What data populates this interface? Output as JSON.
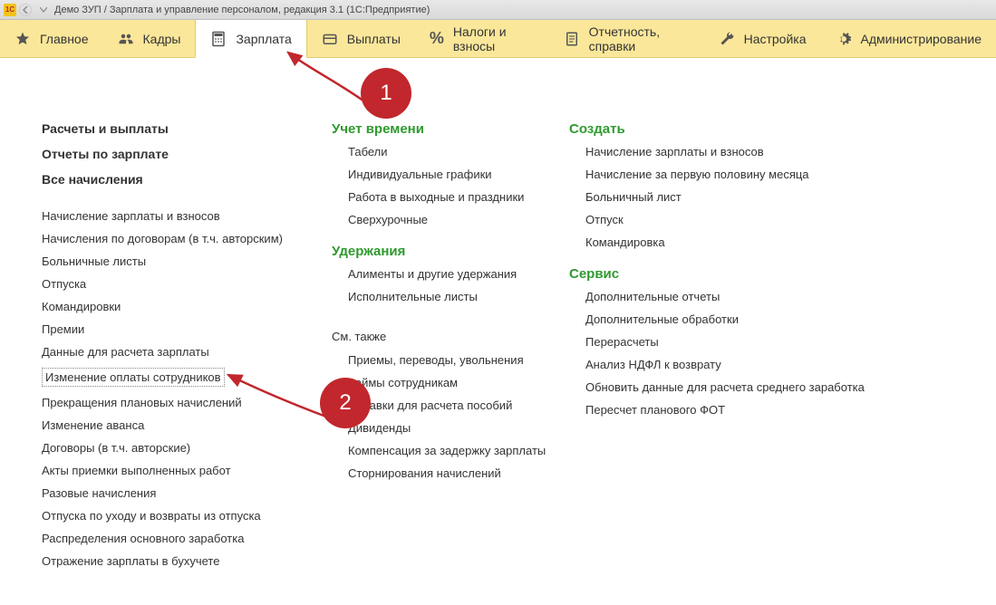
{
  "window": {
    "title": "Демо ЗУП / Зарплата и управление персоналом, редакция 3.1  (1С:Предприятие)"
  },
  "nav": {
    "items": [
      {
        "label": "Главное",
        "icon": "star-icon"
      },
      {
        "label": "Кадры",
        "icon": "people-icon"
      },
      {
        "label": "Зарплата",
        "icon": "calculator-icon",
        "active": true
      },
      {
        "label": "Выплаты",
        "icon": "wallet-icon"
      },
      {
        "label": "Налоги и взносы",
        "icon": "percent-icon"
      },
      {
        "label": "Отчетность, справки",
        "icon": "report-icon"
      },
      {
        "label": "Настройка",
        "icon": "wrench-icon"
      },
      {
        "label": "Администрирование",
        "icon": "gear-icon"
      }
    ]
  },
  "col1": {
    "top": [
      "Расчеты и выплаты",
      "Отчеты по зарплате",
      "Все начисления"
    ],
    "links": [
      "Начисление зарплаты и взносов",
      "Начисления по договорам (в т.ч. авторским)",
      "Больничные листы",
      "Отпуска",
      "Командировки",
      "Премии",
      "Данные для расчета зарплаты",
      "Изменение оплаты сотрудников",
      "Прекращения плановых начислений",
      "Изменение аванса",
      "Договоры (в т.ч. авторские)",
      "Акты приемки выполненных работ",
      "Разовые начисления",
      "Отпуска по уходу и возвраты из отпуска",
      "Распределения основного заработка",
      "Отражение зарплаты в бухучете"
    ]
  },
  "col2": {
    "sections": [
      {
        "head": "Учет времени",
        "items": [
          "Табели",
          "Индивидуальные графики",
          "Работа в выходные и праздники",
          "Сверхурочные"
        ]
      },
      {
        "head": "Удержания",
        "items": [
          "Алименты и другие удержания",
          "Исполнительные листы"
        ]
      }
    ],
    "seealso_label": "См. также",
    "seealso": [
      "Приемы, переводы, увольнения",
      "Займы сотрудникам",
      "Справки для расчета пособий",
      "Дивиденды",
      "Компенсация за задержку зарплаты",
      "Сторнирования начислений"
    ]
  },
  "col3": {
    "sections": [
      {
        "head": "Создать",
        "items": [
          "Начисление зарплаты и взносов",
          "Начисление за первую половину месяца",
          "Больничный лист",
          "Отпуск",
          "Командировка"
        ]
      },
      {
        "head": "Сервис",
        "items": [
          "Дополнительные отчеты",
          "Дополнительные обработки",
          "Перерасчеты",
          "Анализ НДФЛ к возврату",
          "Обновить данные для расчета среднего заработка",
          "Пересчет планового ФОТ"
        ]
      }
    ]
  },
  "badges": {
    "b1": "1",
    "b2": "2"
  }
}
